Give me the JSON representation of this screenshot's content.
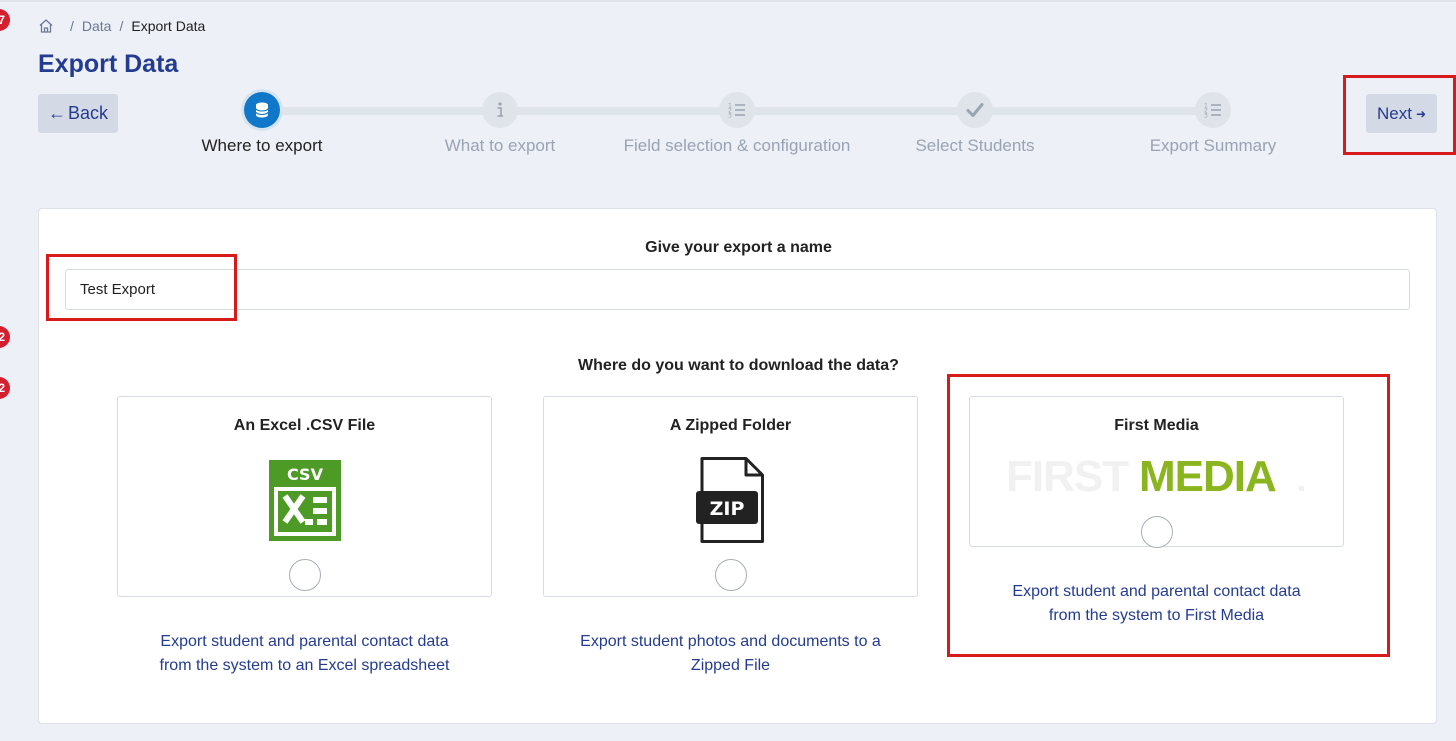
{
  "markers": [
    "7",
    "2",
    "2"
  ],
  "breadcrumb": {
    "home_icon": "home-icon",
    "items": [
      "Data",
      "Export Data"
    ],
    "separator": "/"
  },
  "page": {
    "title": "Export Data"
  },
  "nav": {
    "back_arrow": "←",
    "back_label": "Back",
    "next_label": "Next",
    "next_arrow": "➜"
  },
  "steps": [
    {
      "label": "Where to export",
      "icon": "database-icon",
      "active": true
    },
    {
      "label": "What to export",
      "icon": "info-icon",
      "active": false
    },
    {
      "label": "Field selection & configuration",
      "icon": "list-icon",
      "active": false
    },
    {
      "label": "Select Students",
      "icon": "check-icon",
      "active": false
    },
    {
      "label": "Export Summary",
      "icon": "list-icon",
      "active": false
    }
  ],
  "form": {
    "name_heading": "Give your export a name",
    "name_value": "Test Export",
    "destination_heading": "Where do you want to download the data?"
  },
  "options": [
    {
      "title": "An Excel .CSV File",
      "icon": "csv-file-icon",
      "icon_text": "CSV",
      "description_line1": "Export student and parental contact data",
      "description_line2": "from the system to an Excel spreadsheet"
    },
    {
      "title": "A Zipped Folder",
      "icon": "zip-file-icon",
      "icon_text": "ZIP",
      "description_line1": "Export student photos and documents to a",
      "description_line2": "Zipped File"
    },
    {
      "title": "First Media",
      "icon": "first-media-logo",
      "logo_part1": "FIRST",
      "logo_part2": "MEDIA",
      "description_line1": "Export student and parental contact data",
      "description_line2": "from the system to First Media"
    }
  ],
  "colors": {
    "background": "#edf0f7",
    "accent": "#243c8f",
    "step_active": "#1178c9",
    "annotation": "#d71a1a",
    "csv_green": "#4e9a26",
    "first_media_green": "#8ab51f"
  }
}
